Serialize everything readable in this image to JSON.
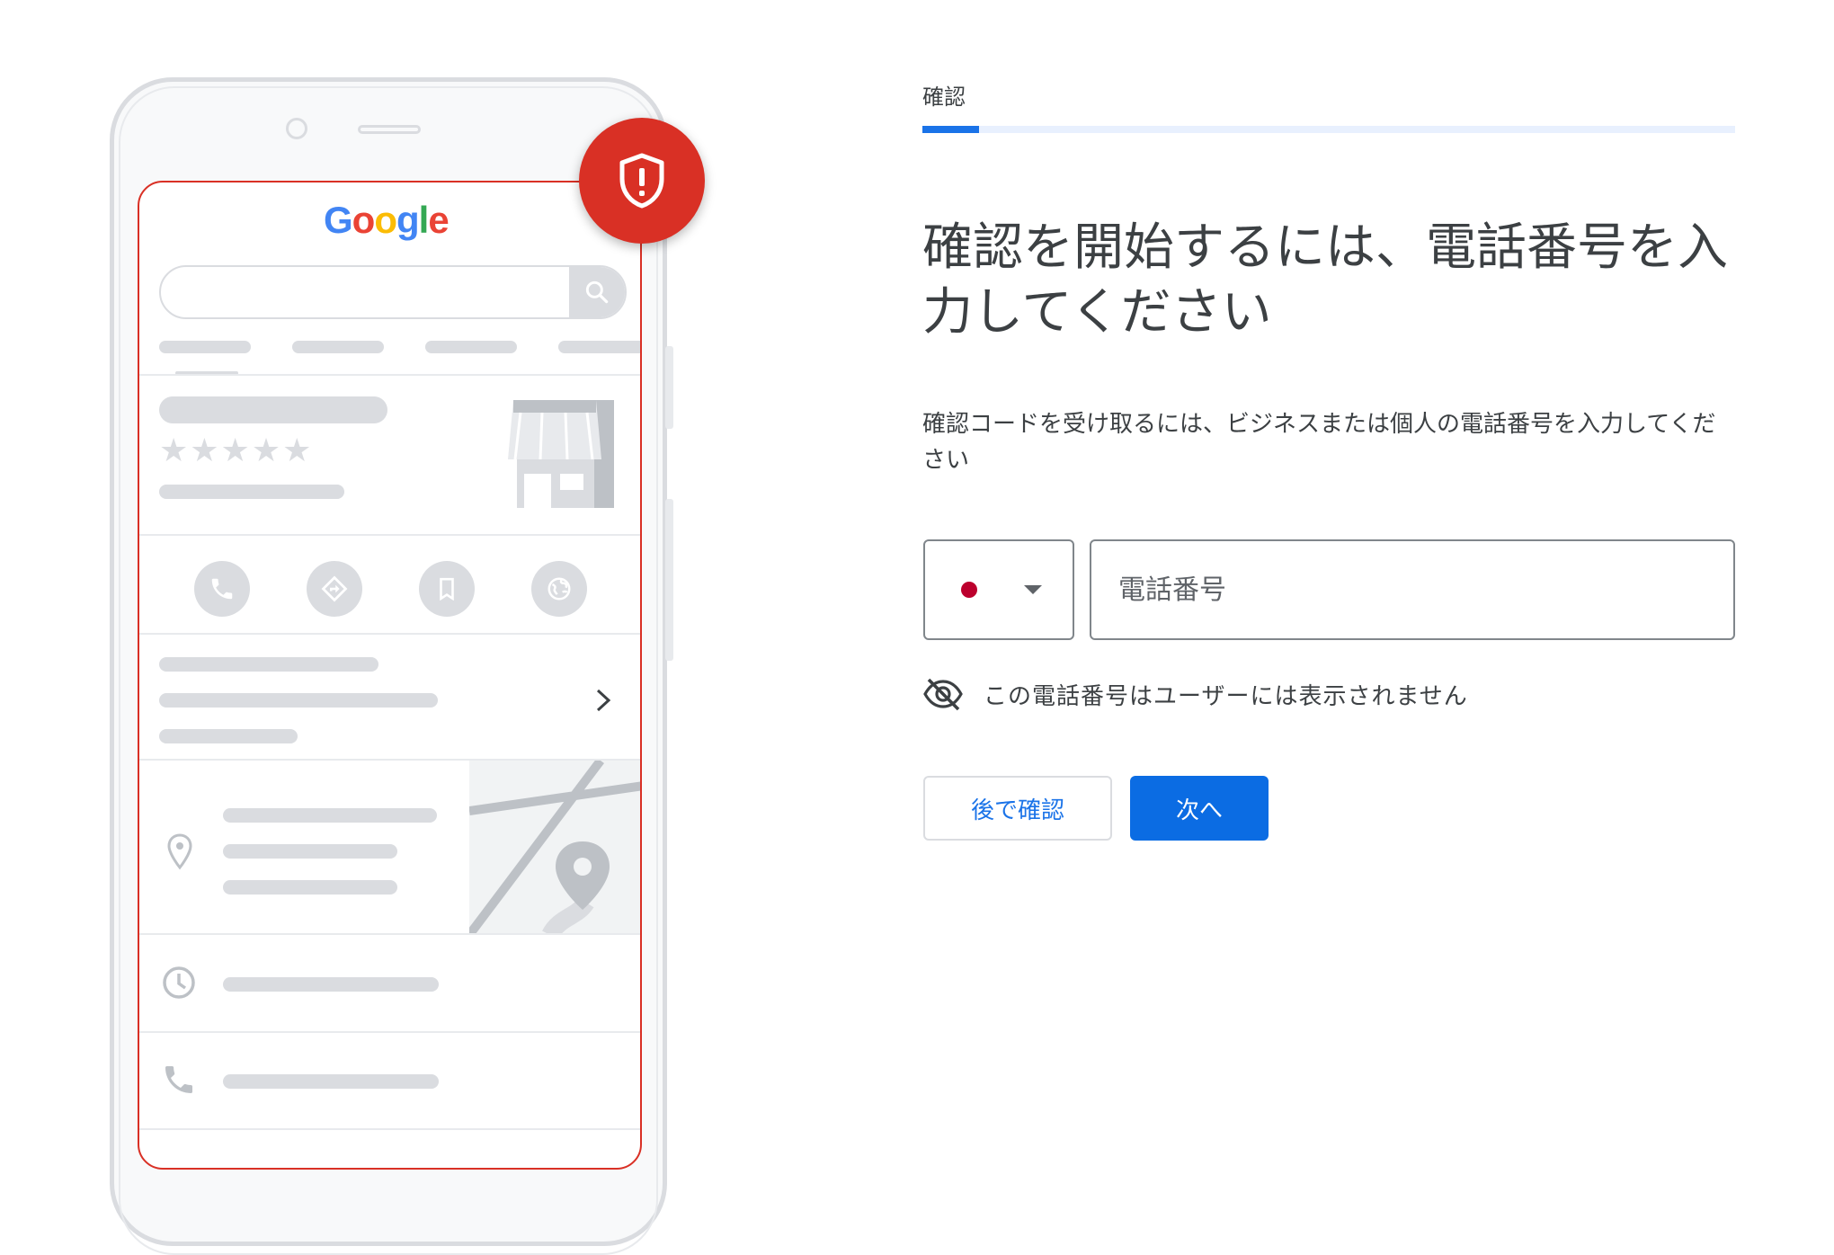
{
  "illustration": {
    "logo_text": "Google",
    "logo_colors": [
      "#4285F4",
      "#EA4335",
      "#FBBC05",
      "#4285F4",
      "#34A853",
      "#EA4335"
    ],
    "rating_stars": "★★★★★",
    "alert_badge_icon": "shield-exclamation-icon",
    "alert_color": "#D93025"
  },
  "step": {
    "label": "確認",
    "progress_fraction": 0.07
  },
  "heading": "確認を開始するには、電話番号を入力してください",
  "description": "確認コードを受け取るには、ビジネスまたは個人の電話番号を入力してください",
  "phone": {
    "country_flag": "japan-flag-icon",
    "placeholder": "電話番号",
    "value": ""
  },
  "privacy_note": "この電話番号はユーザーには表示されません",
  "buttons": {
    "later": "後で確認",
    "next": "次へ"
  },
  "colors": {
    "accent": "#1A73E8",
    "primary_button": "#0B6CE3",
    "flag_red": "#BC002D"
  }
}
